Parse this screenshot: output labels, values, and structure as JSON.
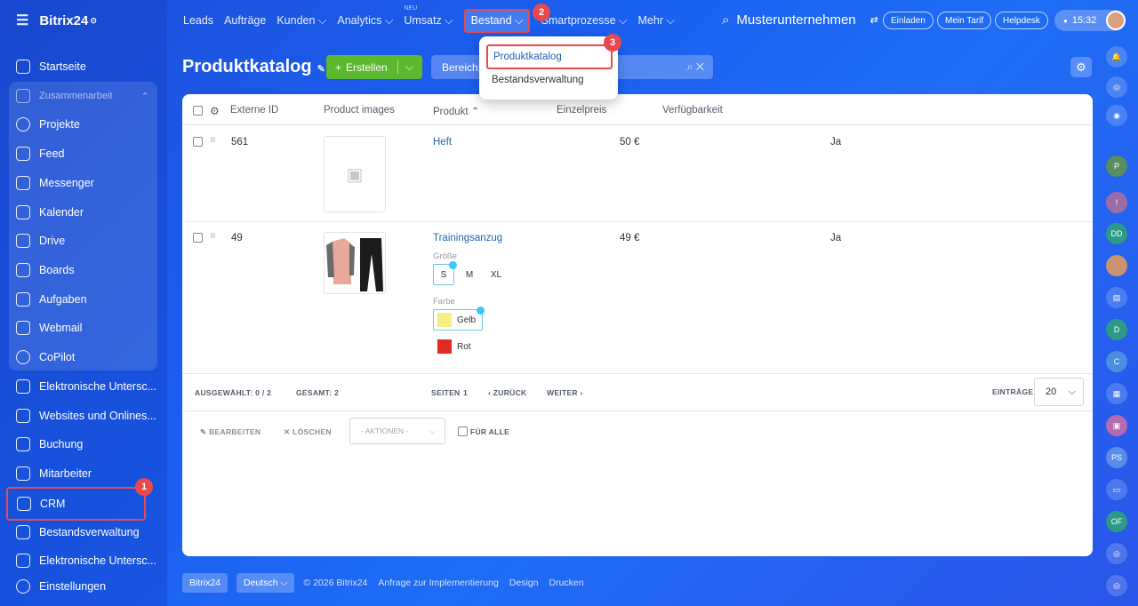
{
  "brand": "Bitrix24",
  "sidebar": {
    "items": [
      "Startseite",
      "Zusammenarbeit",
      "Projekte",
      "Feed",
      "Messenger",
      "Kalender",
      "Drive",
      "Boards",
      "Aufgaben",
      "Webmail",
      "CoPilot",
      "Elektronische Untersc...",
      "Websites und Onlines...",
      "Buchung",
      "Mitarbeiter",
      "CRM",
      "Bestandsverwaltung",
      "Elektronische Untersc...",
      "Einstellungen"
    ]
  },
  "topnav": {
    "items": [
      "Leads",
      "Aufträge",
      "Kunden ⌵",
      "Analytics ⌵",
      "Umsatz ⌵",
      "Bestand ⌵",
      "Smartprozesse ⌵",
      "Mehr ⌵"
    ],
    "new_tag": "NEU"
  },
  "company": "Musterunternehmen",
  "pills": {
    "invite": "Einladen",
    "tariff": "Mein Tarif",
    "helpdesk": "Helpdesk"
  },
  "clock": "15:32",
  "page": {
    "title": "Produktkatalog",
    "create": "Erstellen",
    "search_placeholder": "Bereich:"
  },
  "dropdown": {
    "items": [
      "Produktkatalog",
      "Bestandsverwaltung"
    ]
  },
  "badges": [
    "1",
    "2",
    "3"
  ],
  "table": {
    "headers": [
      "Externe ID",
      "Product images",
      "Produkt",
      "Einzelpreis",
      "Verfügbarkeit"
    ],
    "rows": [
      {
        "id": "561",
        "product": "Heft",
        "price": "50 €",
        "available": "Ja"
      },
      {
        "id": "49",
        "product": "Trainingsanzug",
        "price": "49 €",
        "available": "Ja"
      }
    ],
    "size_label": "Größe",
    "sizes": [
      "S",
      "M",
      "XL"
    ],
    "color_label": "Farbe",
    "colors": [
      "Gelb",
      "Rot"
    ]
  },
  "pager": {
    "selected": "AUSGEWÄHLT: 0 / 2",
    "total": "GESAMT: 2",
    "pages": "SEITEN",
    "page_num": "1",
    "back": "ZURÜCK",
    "next": "WEITER",
    "entries_label": "EINTRÄGE",
    "entries": "20"
  },
  "actions": {
    "edit": "BEARBEITEN",
    "delete": "LÖSCHEN",
    "select": "- AKTIONEN -",
    "for_all": "FÜR ALLE"
  },
  "footer": {
    "brand": "Bitrix24",
    "lang": "Deutsch",
    "copyright": "© 2026 Bitrix24",
    "links": [
      "Anfrage zur Implementierung",
      "Design",
      "Drucken"
    ]
  },
  "rail": {
    "initials": [
      "P",
      "DD",
      "D",
      "C",
      "PS",
      "OF"
    ]
  }
}
